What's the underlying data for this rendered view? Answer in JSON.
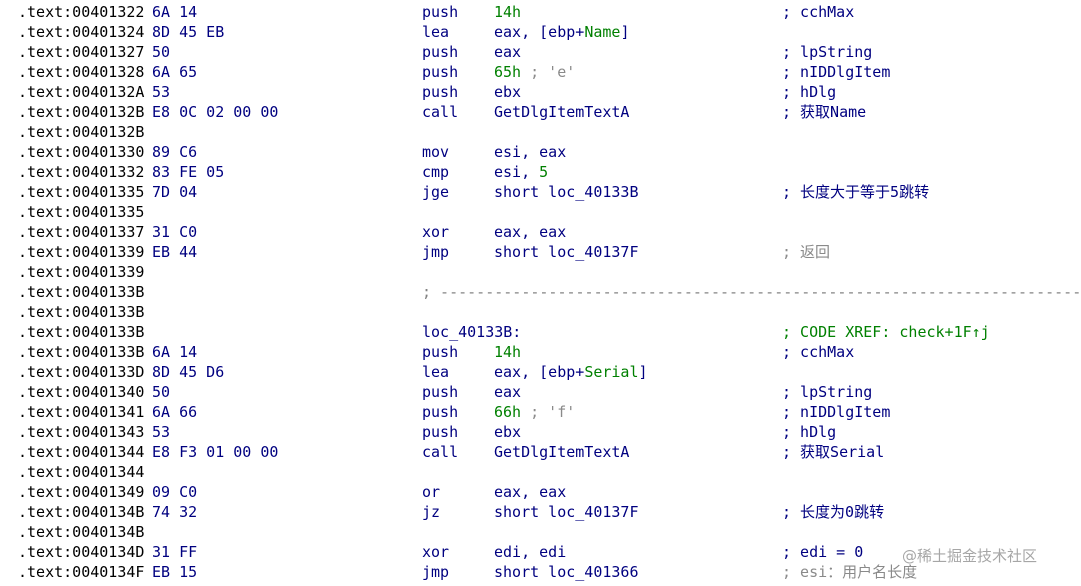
{
  "listing": [
    {
      "addr": ".text:00401322",
      "bytes": "6A 14",
      "mnemonic": "push",
      "operand": [
        {
          "t": "14h",
          "c": "g"
        }
      ],
      "comment": "; cchMax"
    },
    {
      "addr": ".text:00401324",
      "bytes": "8D 45 EB",
      "mnemonic": "lea",
      "operand": [
        {
          "t": "eax, [ebp+",
          "c": ""
        },
        {
          "t": "Name",
          "c": "g"
        },
        {
          "t": "]",
          "c": ""
        }
      ],
      "comment": ""
    },
    {
      "addr": ".text:00401327",
      "bytes": "50",
      "mnemonic": "push",
      "operand": [
        {
          "t": "eax",
          "c": ""
        }
      ],
      "comment": "; lpString"
    },
    {
      "addr": ".text:00401328",
      "bytes": "6A 65",
      "mnemonic": "push",
      "operand": [
        {
          "t": "65h",
          "c": "g"
        },
        {
          "t": " ; 'e'",
          "c": "x"
        }
      ],
      "comment": "; nIDDlgItem"
    },
    {
      "addr": ".text:0040132A",
      "bytes": "53",
      "mnemonic": "push",
      "operand": [
        {
          "t": "ebx",
          "c": ""
        }
      ],
      "comment": "; hDlg"
    },
    {
      "addr": ".text:0040132B",
      "bytes": "E8 0C 02 00 00",
      "mnemonic": "call",
      "operand": [
        {
          "t": "GetDlgItemTextA",
          "c": ""
        }
      ],
      "comment": "; 获取Name"
    },
    {
      "addr": ".text:0040132B",
      "bytes": "",
      "mnemonic": "",
      "operand": [],
      "comment": ""
    },
    {
      "addr": ".text:00401330",
      "bytes": "89 C6",
      "mnemonic": "mov",
      "operand": [
        {
          "t": "esi, eax",
          "c": ""
        }
      ],
      "comment": ""
    },
    {
      "addr": ".text:00401332",
      "bytes": "83 FE 05",
      "mnemonic": "cmp",
      "operand": [
        {
          "t": "esi, ",
          "c": ""
        },
        {
          "t": "5",
          "c": "g"
        }
      ],
      "comment": ""
    },
    {
      "addr": ".text:00401335",
      "bytes": "7D 04",
      "mnemonic": "jge",
      "operand": [
        {
          "t": "short loc_40133B",
          "c": ""
        }
      ],
      "comment": "; 长度大于等于5跳转"
    },
    {
      "addr": ".text:00401335",
      "bytes": "",
      "mnemonic": "",
      "operand": [],
      "comment": ""
    },
    {
      "addr": ".text:00401337",
      "bytes": "31 C0",
      "mnemonic": "xor",
      "operand": [
        {
          "t": "eax, eax",
          "c": ""
        }
      ],
      "comment": ""
    },
    {
      "addr": ".text:00401339",
      "bytes": "EB 44",
      "mnemonic": "jmp",
      "operand": [
        {
          "t": "short loc_40137F",
          "c": ""
        }
      ],
      "comment": "; 返回",
      "comment_gray": true
    },
    {
      "addr": ".text:00401339",
      "bytes": "",
      "mnemonic": "",
      "operand": [],
      "comment": ""
    },
    {
      "addr": ".text:0040133B",
      "bytes": "",
      "separator": "; ---------------------------------------------------------------------------"
    },
    {
      "addr": ".text:0040133B",
      "bytes": "",
      "mnemonic": "",
      "operand": [],
      "comment": ""
    },
    {
      "addr": ".text:0040133B",
      "bytes": "",
      "label": "loc_40133B:",
      "comment": "; CODE XREF: check+1F↑j",
      "comment_green": true
    },
    {
      "addr": ".text:0040133B",
      "bytes": "6A 14",
      "mnemonic": "push",
      "operand": [
        {
          "t": "14h",
          "c": "g"
        }
      ],
      "comment": "; cchMax"
    },
    {
      "addr": ".text:0040133D",
      "bytes": "8D 45 D6",
      "mnemonic": "lea",
      "operand": [
        {
          "t": "eax, [ebp+",
          "c": ""
        },
        {
          "t": "Serial",
          "c": "g"
        },
        {
          "t": "]",
          "c": ""
        }
      ],
      "comment": ""
    },
    {
      "addr": ".text:00401340",
      "bytes": "50",
      "mnemonic": "push",
      "operand": [
        {
          "t": "eax",
          "c": ""
        }
      ],
      "comment": "; lpString"
    },
    {
      "addr": ".text:00401341",
      "bytes": "6A 66",
      "mnemonic": "push",
      "operand": [
        {
          "t": "66h",
          "c": "g"
        },
        {
          "t": " ; 'f'",
          "c": "x"
        }
      ],
      "comment": "; nIDDlgItem"
    },
    {
      "addr": ".text:00401343",
      "bytes": "53",
      "mnemonic": "push",
      "operand": [
        {
          "t": "ebx",
          "c": ""
        }
      ],
      "comment": "; hDlg"
    },
    {
      "addr": ".text:00401344",
      "bytes": "E8 F3 01 00 00",
      "mnemonic": "call",
      "operand": [
        {
          "t": "GetDlgItemTextA",
          "c": ""
        }
      ],
      "comment": "; 获取Serial"
    },
    {
      "addr": ".text:00401344",
      "bytes": "",
      "mnemonic": "",
      "operand": [],
      "comment": ""
    },
    {
      "addr": ".text:00401349",
      "bytes": "09 C0",
      "mnemonic": "or",
      "operand": [
        {
          "t": "eax, eax",
          "c": ""
        }
      ],
      "comment": ""
    },
    {
      "addr": ".text:0040134B",
      "bytes": "74 32",
      "mnemonic": "jz",
      "operand": [
        {
          "t": "short loc_40137F",
          "c": ""
        }
      ],
      "comment": "; 长度为0跳转"
    },
    {
      "addr": ".text:0040134B",
      "bytes": "",
      "mnemonic": "",
      "operand": [],
      "comment": ""
    },
    {
      "addr": ".text:0040134D",
      "bytes": "31 FF",
      "mnemonic": "xor",
      "operand": [
        {
          "t": "edi, edi",
          "c": ""
        }
      ],
      "comment": "; edi = 0"
    },
    {
      "addr": ".text:0040134F",
      "bytes": "EB 15",
      "mnemonic": "jmp",
      "operand": [
        {
          "t": "short loc_401366",
          "c": ""
        }
      ],
      "comment": "; esi：用户名长度",
      "comment_gray": true
    }
  ],
  "watermark": "@稀土掘金技术社区"
}
